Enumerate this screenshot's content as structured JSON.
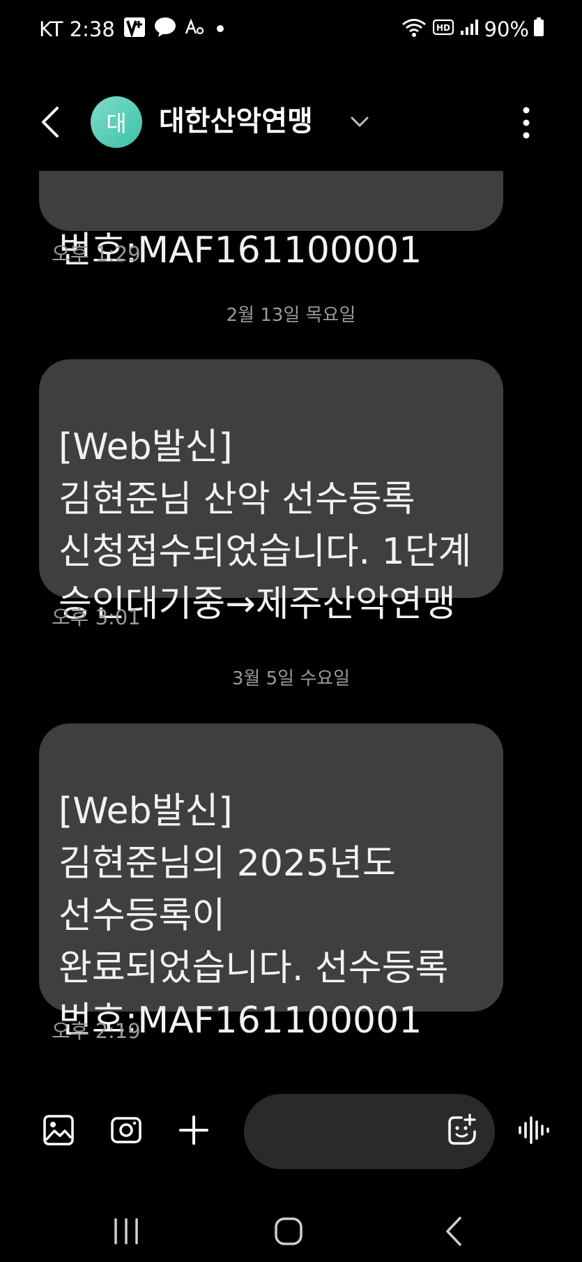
{
  "status_bar": {
    "carrier_time": "KT 2:38",
    "battery": "90%"
  },
  "header": {
    "avatar_initial": "대",
    "contact_name": "대한산악연맹"
  },
  "messages": [
    {
      "text": "번호:MAF161100001",
      "time": "오후 1:29"
    },
    {
      "date": "2월 13일 목요일",
      "text": "[Web발신]\n김현준님 산악 선수등록\n신청접수되었습니다. 1단계\n승인대기중→제주산악연맹",
      "time": "오후 3:01"
    },
    {
      "date": "3월 5일 수요일",
      "text": "[Web발신]\n김현준님의 2025년도\n선수등록이\n완료되었습니다. 선수등록\n번호:MAF161100001",
      "time": "오후 2:19"
    }
  ],
  "composer": {
    "placeholder": ""
  },
  "colors": {
    "background": "#000000",
    "bubble": "#3f3f3f",
    "avatar_accent": "#5fd0b8",
    "meta_text": "#9b9b9b"
  },
  "icons": {
    "status_left": [
      "v-plus-icon",
      "kakaotalk-icon",
      "font-icon",
      "dot-icon"
    ],
    "status_right": [
      "wifi-icon",
      "hd-icon",
      "signal-icon",
      "battery-icon"
    ],
    "composer": [
      "gallery-icon",
      "camera-icon",
      "plus-icon",
      "emoji-sticker-icon",
      "voice-icon"
    ],
    "nav": [
      "recent-apps-icon",
      "home-icon",
      "back-icon"
    ]
  }
}
